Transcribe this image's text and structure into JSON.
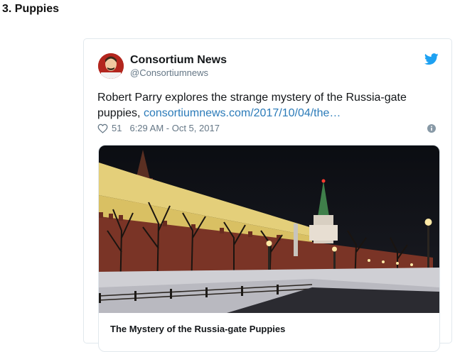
{
  "heading": "3. Puppies",
  "tweet": {
    "author_name": "Consortium News",
    "author_handle": "@Consortiumnews",
    "text": "Robert Parry explores the strange mystery of the Russia-gate puppies, ",
    "link_text": "consortiumnews.com/2017/10/04/the…",
    "likes": "51",
    "timestamp": "6:29 AM - Oct 5, 2017",
    "card_title": "The Mystery of the Russia-gate Puppies"
  },
  "colors": {
    "link": "#2b7bb9",
    "twitter_blue": "#1da1f2",
    "meta_gray": "#657786",
    "border": "#e1e8ed"
  },
  "icons": [
    "twitter-bird-icon",
    "heart-icon",
    "info-icon"
  ]
}
